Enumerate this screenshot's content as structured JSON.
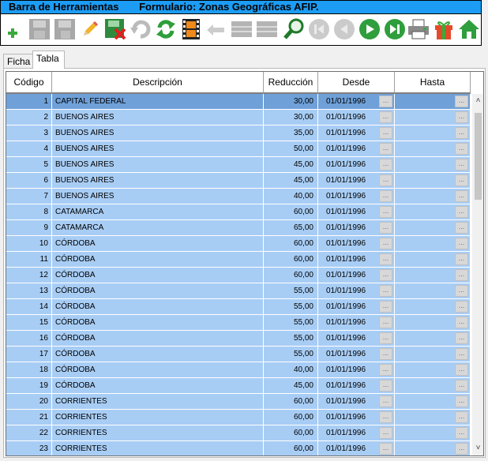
{
  "titlebar": {
    "left": "Barra de Herramientas",
    "right": "Formulario: Zonas Geográficas AFIP."
  },
  "toolbar": {
    "buttons": [
      {
        "icon": "add-icon",
        "enabled": true
      },
      {
        "icon": "save-icon",
        "enabled": false
      },
      {
        "icon": "save-as-icon",
        "enabled": false
      },
      {
        "icon": "edit-pencil-icon",
        "enabled": true
      },
      {
        "icon": "delete-icon",
        "enabled": true
      },
      {
        "icon": "undo-icon",
        "enabled": false
      },
      {
        "icon": "refresh-icon",
        "enabled": true
      },
      {
        "icon": "film-icon",
        "enabled": true
      },
      {
        "icon": "back-arrow-icon",
        "enabled": false
      },
      {
        "icon": "grid-icon",
        "enabled": false
      },
      {
        "icon": "grid-icon",
        "enabled": false
      },
      {
        "icon": "search-icon",
        "enabled": true
      },
      {
        "icon": "first-record-icon",
        "enabled": false
      },
      {
        "icon": "previous-record-icon",
        "enabled": false
      },
      {
        "icon": "next-record-icon",
        "enabled": true
      },
      {
        "icon": "last-record-icon",
        "enabled": true
      },
      {
        "icon": "printer-icon",
        "enabled": true
      },
      {
        "icon": "gift-icon",
        "enabled": true
      },
      {
        "icon": "home-icon",
        "enabled": true
      }
    ]
  },
  "tabs": [
    {
      "label": "Ficha",
      "active": false
    },
    {
      "label": "Tabla",
      "active": true
    }
  ],
  "table": {
    "columns": [
      "Código",
      "Descripción",
      "Reducción",
      "Desde",
      "Hasta"
    ],
    "ellipsis": "...",
    "rows": [
      {
        "codigo": "1",
        "descripcion": "CAPITAL FEDERAL",
        "reduccion": "30,00",
        "desde": "01/01/1996",
        "hasta": "",
        "selected": true
      },
      {
        "codigo": "2",
        "descripcion": "BUENOS AIRES",
        "reduccion": "30,00",
        "desde": "01/01/1996",
        "hasta": ""
      },
      {
        "codigo": "3",
        "descripcion": "BUENOS AIRES",
        "reduccion": "35,00",
        "desde": "01/01/1996",
        "hasta": ""
      },
      {
        "codigo": "4",
        "descripcion": "BUENOS AIRES",
        "reduccion": "50,00",
        "desde": "01/01/1996",
        "hasta": ""
      },
      {
        "codigo": "5",
        "descripcion": "BUENOS AIRES",
        "reduccion": "45,00",
        "desde": "01/01/1996",
        "hasta": ""
      },
      {
        "codigo": "6",
        "descripcion": "BUENOS AIRES",
        "reduccion": "45,00",
        "desde": "01/01/1996",
        "hasta": ""
      },
      {
        "codigo": "7",
        "descripcion": "BUENOS AIRES",
        "reduccion": "40,00",
        "desde": "01/01/1996",
        "hasta": ""
      },
      {
        "codigo": "8",
        "descripcion": "CATAMARCA",
        "reduccion": "60,00",
        "desde": "01/01/1996",
        "hasta": ""
      },
      {
        "codigo": "9",
        "descripcion": "CATAMARCA",
        "reduccion": "65,00",
        "desde": "01/01/1996",
        "hasta": ""
      },
      {
        "codigo": "10",
        "descripcion": "CÓRDOBA",
        "reduccion": "60,00",
        "desde": "01/01/1996",
        "hasta": ""
      },
      {
        "codigo": "11",
        "descripcion": "CÓRDOBA",
        "reduccion": "60,00",
        "desde": "01/01/1996",
        "hasta": ""
      },
      {
        "codigo": "12",
        "descripcion": "CÓRDOBA",
        "reduccion": "60,00",
        "desde": "01/01/1996",
        "hasta": ""
      },
      {
        "codigo": "13",
        "descripcion": "CÓRDOBA",
        "reduccion": "55,00",
        "desde": "01/01/1996",
        "hasta": ""
      },
      {
        "codigo": "14",
        "descripcion": "CÓRDOBA",
        "reduccion": "55,00",
        "desde": "01/01/1996",
        "hasta": ""
      },
      {
        "codigo": "15",
        "descripcion": "CÓRDOBA",
        "reduccion": "55,00",
        "desde": "01/01/1996",
        "hasta": ""
      },
      {
        "codigo": "16",
        "descripcion": "CÓRDOBA",
        "reduccion": "55,00",
        "desde": "01/01/1996",
        "hasta": ""
      },
      {
        "codigo": "17",
        "descripcion": "CÓRDOBA",
        "reduccion": "55,00",
        "desde": "01/01/1996",
        "hasta": ""
      },
      {
        "codigo": "18",
        "descripcion": "CÓRDOBA",
        "reduccion": "40,00",
        "desde": "01/01/1996",
        "hasta": ""
      },
      {
        "codigo": "19",
        "descripcion": "CÓRDOBA",
        "reduccion": "45,00",
        "desde": "01/01/1996",
        "hasta": ""
      },
      {
        "codigo": "20",
        "descripcion": "CORRIENTES",
        "reduccion": "60,00",
        "desde": "01/01/1996",
        "hasta": ""
      },
      {
        "codigo": "21",
        "descripcion": "CORRIENTES",
        "reduccion": "60,00",
        "desde": "01/01/1996",
        "hasta": ""
      },
      {
        "codigo": "22",
        "descripcion": "CORRIENTES",
        "reduccion": "60,00",
        "desde": "01/01/1996",
        "hasta": ""
      },
      {
        "codigo": "23",
        "descripcion": "CORRIENTES",
        "reduccion": "60,00",
        "desde": "01/01/1996",
        "hasta": ""
      }
    ]
  },
  "scrollbar": {
    "up": "˄",
    "down": "˅"
  }
}
